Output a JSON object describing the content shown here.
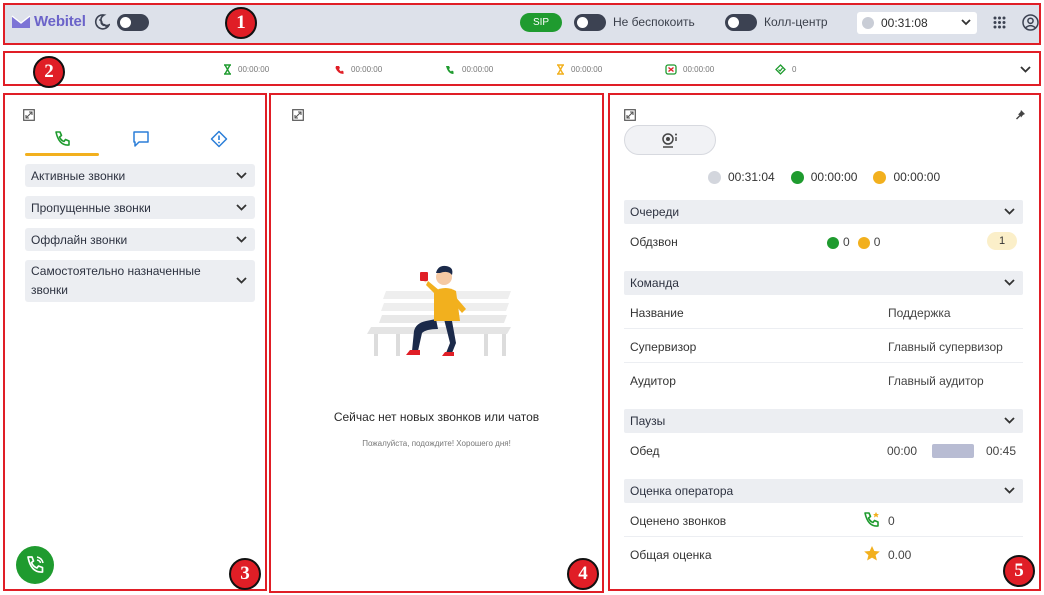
{
  "annotations": [
    "1",
    "2",
    "3",
    "4",
    "5"
  ],
  "header": {
    "logo": "Webitel",
    "sip_label": "SIP",
    "dnd_label": "Не беспокоить",
    "callcenter_label": "Колл-центр",
    "status_time": "00:31:08",
    "icons": [
      "moon-phone-icon",
      "apps-grid-icon",
      "account-icon"
    ]
  },
  "stats": [
    {
      "icon": "ringing-hourglass-icon",
      "color": "#1f9b2f",
      "value": "00:00:00"
    },
    {
      "icon": "missed-call-icon",
      "color": "#e01e26",
      "value": "00:00:00"
    },
    {
      "icon": "talking-icon",
      "color": "#1f9b2f",
      "value": "00:00:00"
    },
    {
      "icon": "hold-hourglass-icon",
      "color": "#f2b01e",
      "value": "00:00:00"
    },
    {
      "icon": "hangup-icon",
      "color": "#e01e26",
      "value": "00:00:00"
    },
    {
      "icon": "diamond-check-icon",
      "color": "#1f9b2f",
      "value": "0"
    }
  ],
  "left_panel": {
    "tabs": [
      "phone-tab",
      "chat-tab",
      "alert-tab"
    ],
    "sections": [
      {
        "label": "Активные звонки"
      },
      {
        "label": "Пропущенные звонки"
      },
      {
        "label": "Оффлайн звонки"
      },
      {
        "label": "Самостоятельно назначенные\nзвонки"
      }
    ]
  },
  "center_panel": {
    "empty_title": "Сейчас нет новых звонков или чатов",
    "empty_subtitle": "Пожалуйста, подождите! Хорошего дня!"
  },
  "right_panel": {
    "timers": [
      {
        "color": "#d3d6dd",
        "value": "00:31:04"
      },
      {
        "color": "#1f9b2f",
        "value": "00:00:00"
      },
      {
        "color": "#f2b01e",
        "value": "00:00:00"
      }
    ],
    "queues": {
      "title": "Очереди",
      "rows": [
        {
          "name": "Обдзвон",
          "green": "0",
          "yellow": "0",
          "count": "1"
        }
      ]
    },
    "team": {
      "title": "Команда",
      "rows": [
        {
          "label": "Название",
          "value": "Поддержка"
        },
        {
          "label": "Супервизор",
          "value": "Главный супервизор"
        },
        {
          "label": "Аудитор",
          "value": "Главный аудитор"
        }
      ]
    },
    "pauses": {
      "title": "Паузы",
      "rows": [
        {
          "label": "Обед",
          "from": "00:00",
          "to": "00:45"
        }
      ]
    },
    "rating": {
      "title": "Оценка оператора",
      "rows": [
        {
          "label": "Оценено звонков",
          "value": "0"
        },
        {
          "label": "Общая оценка",
          "value": "0.00"
        }
      ]
    }
  }
}
